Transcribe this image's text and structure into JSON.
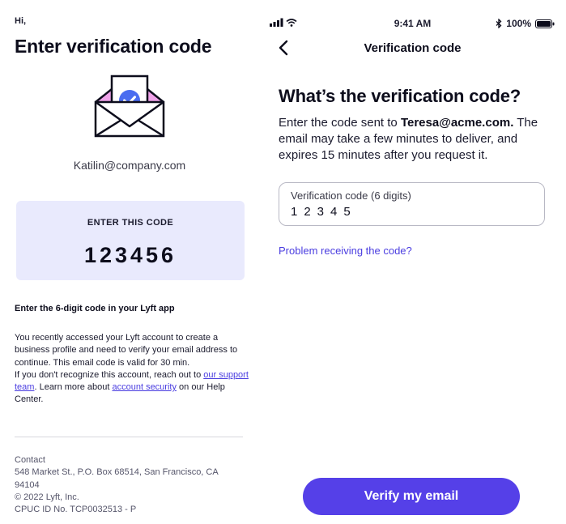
{
  "email": {
    "greeting": "Hi,",
    "title": "Enter verification code",
    "recipient": "Katilin@company.com",
    "code_label": "ENTER THIS CODE",
    "code": "123456",
    "instruction_heading": "Enter the 6-digit code in your Lyft app",
    "body_paragraph": "You recently accessed your Lyft account to create a business profile and need to verify your email address to continue. This email code is valid for 30 min.",
    "body_line2_pre": "If you don't recognize this account, reach out to ",
    "support_link": "our support team",
    "body_line2_mid": ". Learn more about ",
    "security_link": "account security",
    "body_line2_post": " on our Help Center.",
    "footer": {
      "contact": "Contact",
      "address_line1": "548 Market St., P.O. Box 68514, San Francisco, CA",
      "address_line2": "94104",
      "copyright": "© 2022 Lyft, Inc.",
      "cpuc": "CPUC ID No. TCP0032513 - P"
    },
    "envelope_colors": {
      "flap": "#f0a3ea",
      "badge": "#4a6cf0",
      "stroke": "#0d0d1c"
    }
  },
  "app": {
    "status_bar": {
      "time": "9:41 AM",
      "battery": "100%"
    },
    "nav_title": "Verification code",
    "heading": "What’s the verification code?",
    "description_pre": "Enter the code sent to ",
    "description_email": "Teresa@acme.com.",
    "description_post": " The email may take a few minutes to deliver, and expires 15 minutes after you request it.",
    "field_label": "Verification code (6 digits)",
    "field_value": "12345",
    "problem_link": "Problem receiving the code?",
    "verify_button": "Verify my email",
    "accent_color": "#5540e8"
  }
}
